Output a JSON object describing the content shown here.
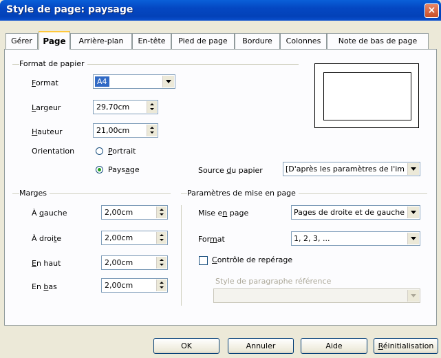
{
  "window": {
    "title": "Style de page: paysage",
    "close_symbol": "×"
  },
  "tabs": [
    {
      "label": "Gérer"
    },
    {
      "label": "Page"
    },
    {
      "label": "Arrière-plan"
    },
    {
      "label": "En-tête"
    },
    {
      "label": "Pied de page"
    },
    {
      "label": "Bordure"
    },
    {
      "label": "Colonnes"
    },
    {
      "label": "Note de bas de page"
    }
  ],
  "paper": {
    "group_label": "Format de papier",
    "format_label": "Format",
    "format_value": "A4",
    "width_label": "Largeur",
    "width_value": "29,70cm",
    "height_label": "Hauteur",
    "height_value": "21,00cm",
    "orientation_label": "Orientation",
    "portrait_label": "Portrait",
    "landscape_label": "Paysage",
    "orientation_selected": "Paysage",
    "source_label": "Source du papier",
    "source_value": "[D'après les paramètres de l'im"
  },
  "margins": {
    "group_label": "Marges",
    "left_label": "À gauche",
    "left_value": "2,00cm",
    "right_label": "À droite",
    "right_value": "2,00cm",
    "top_label": "En haut",
    "top_value": "2,00cm",
    "bottom_label": "En bas",
    "bottom_value": "2,00cm"
  },
  "layout": {
    "group_label": "Paramètres de mise en page",
    "page_layout_label": "Mise en page",
    "page_layout_value": "Pages de droite et de gauche",
    "format_label": "Format",
    "format_value": "1, 2, 3, ...",
    "register_label": "Contrôle de repérage",
    "register_checked": false,
    "ref_style_label": "Style de paragraphe référence",
    "ref_style_value": ""
  },
  "buttons": {
    "ok": "OK",
    "cancel": "Annuler",
    "help": "Aide",
    "reset": "Réinitialisation"
  },
  "colors": {
    "titlebar": "#0447c2",
    "dialog_bg": "#ece9d8",
    "selection": "#316ac5"
  }
}
